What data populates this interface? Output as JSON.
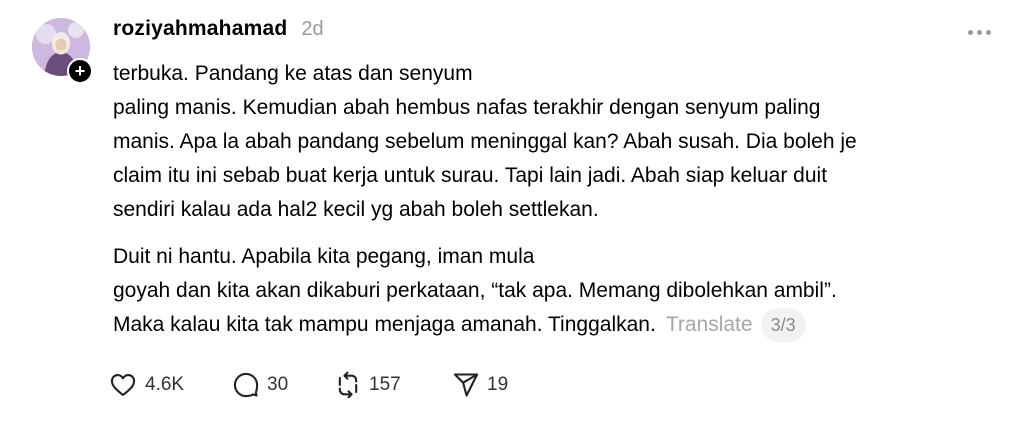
{
  "post": {
    "username": "roziyahmahamad",
    "time": "2d",
    "paragraphs": [
      [
        "terbuka. Pandang ke atas dan senyum",
        "paling manis. Kemudian abah hembus nafas terakhir dengan senyum paling",
        "manis. Apa la abah pandang sebelum meninggal kan? Abah susah. Dia boleh je",
        "claim itu ini sebab buat kerja untuk surau. Tapi lain jadi. Abah siap keluar duit",
        "sendiri kalau ada hal2 kecil yg abah boleh settlekan."
      ],
      [
        "Duit ni hantu. Apabila kita pegang, iman mula",
        "goyah dan kita akan dikaburi perkataan, “tak apa. Memang dibolehkan ambil”.",
        "Maka kalau kita tak mampu menjaga amanah. Tinggalkan."
      ]
    ],
    "translate_label": "Translate",
    "page_indicator": "3/3"
  },
  "actions": {
    "likes": "4.6K",
    "replies": "30",
    "reposts": "157",
    "shares": "19"
  },
  "icons": {
    "follow": "plus-icon",
    "more": "more-horizontal-icon",
    "like": "heart-icon",
    "reply": "comment-bubble-icon",
    "repost": "repost-icon",
    "share": "send-icon"
  }
}
